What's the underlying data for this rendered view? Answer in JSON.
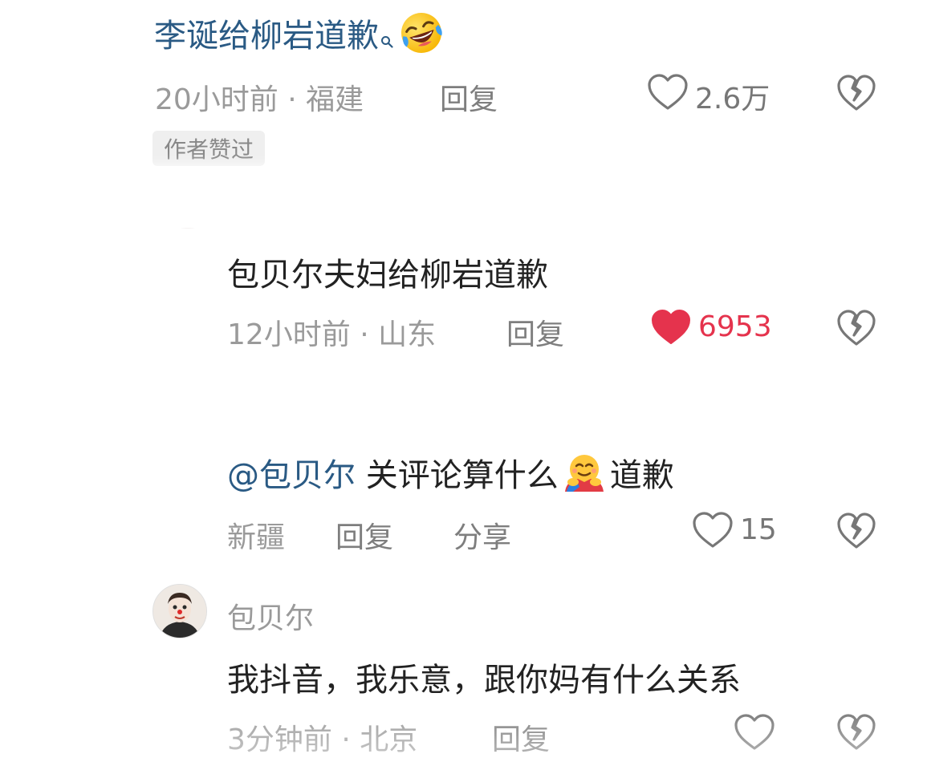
{
  "comment1": {
    "text": "李诞给柳岩道歉",
    "search_icon": "search-icon",
    "emoji": "rolling-laughing-emoji",
    "meta": "20小时前 · 福建",
    "reply_label": "回复",
    "like_count": "2.6万",
    "badge": "作者赞过"
  },
  "comment2": {
    "text": "包贝尔夫妇给柳岩道歉",
    "meta": "12小时前 · 山东",
    "reply_label": "回复",
    "like_count": "6953",
    "liked": true
  },
  "comment3": {
    "mention": "@包贝尔",
    "text_before_emoji": " 关评论算什么",
    "emoji": "hugging-face-emoji",
    "text_after_emoji": "道歉",
    "meta": "新疆",
    "reply_label": "回复",
    "share_label": "分享",
    "like_count": "15"
  },
  "comment4": {
    "username": "包贝尔",
    "text": "我抖音，我乐意，跟你妈有什么关系",
    "meta": "3分钟前 · 北京",
    "reply_label": "回复"
  },
  "colors": {
    "link": "#2a5a84",
    "liked": "#e5334d",
    "meta": "#9a9a9a",
    "text": "#222222"
  }
}
